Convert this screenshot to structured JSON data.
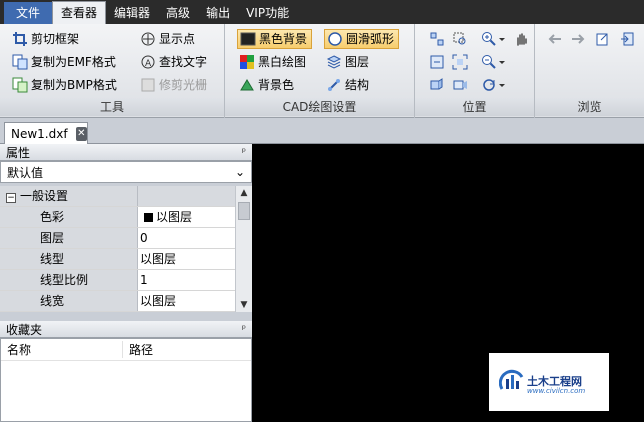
{
  "menu": {
    "items": [
      "文件",
      "查看器",
      "编辑器",
      "高级",
      "输出",
      "VIP功能"
    ],
    "active": "查看器"
  },
  "ribbon": {
    "tools": {
      "label": "工具",
      "buttons": [
        "剪切框架",
        "复制为EMF格式",
        "复制为BMP格式",
        "显示点",
        "查找文字",
        "修剪光栅"
      ]
    },
    "cad": {
      "label": "CAD绘图设置",
      "buttons": [
        "黑色背景",
        "黑白绘图",
        "背景色",
        "圆滑弧形",
        "图层",
        "结构"
      ]
    },
    "position": {
      "label": "位置"
    },
    "browse": {
      "label": "浏览"
    }
  },
  "doc_tab": {
    "name": "New1.dxf",
    "close": "✕"
  },
  "properties": {
    "title": "属性",
    "pin": "ᵖ",
    "dropdown_value": "默认值",
    "section": "一般设置",
    "expander": "−",
    "rows": [
      {
        "key": "色彩",
        "value": "以图层"
      },
      {
        "key": "图层",
        "value": "0"
      },
      {
        "key": "线型",
        "value": "以图层"
      },
      {
        "key": "线型比例",
        "value": "1"
      },
      {
        "key": "线宽",
        "value": "以图层"
      }
    ]
  },
  "favorites": {
    "title": "收藏夹",
    "pin": "ᵖ",
    "columns": [
      "名称",
      "路径"
    ]
  },
  "watermark": {
    "name": "土木工程网",
    "url": "www.civilcn.com"
  },
  "colors": {
    "accent": "#3f6bb0",
    "checked": "#f7cd6d",
    "canvas": "#000000"
  }
}
